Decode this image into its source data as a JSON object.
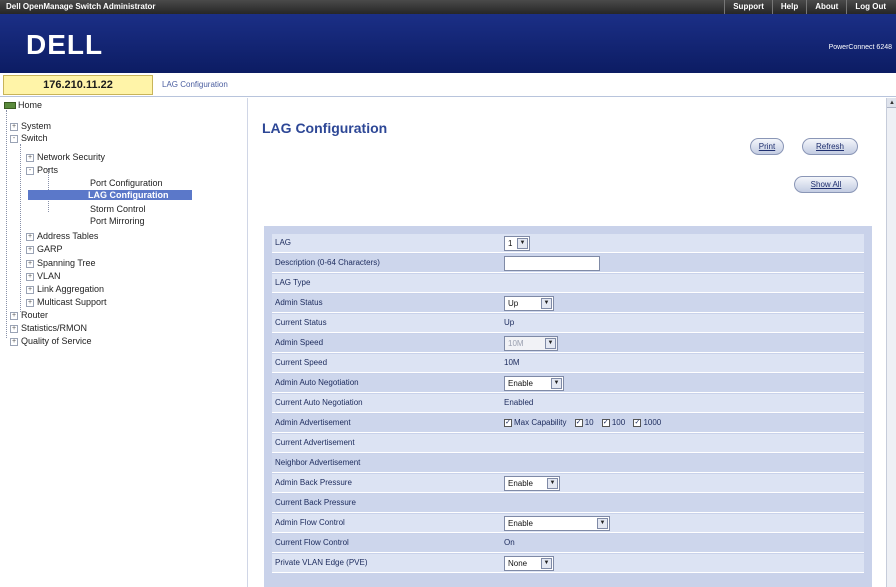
{
  "app_title": "Dell OpenManage Switch Administrator",
  "top_links": [
    "Support",
    "Help",
    "About",
    "Log Out"
  ],
  "brand": "DELL",
  "model": "PowerConnect 6248",
  "ip_address": "176.210.11.22",
  "breadcrumb": "LAG Configuration",
  "tree": {
    "home": "Home",
    "system": "System",
    "switch": "Switch",
    "network_security": "Network Security",
    "ports": "Ports",
    "port_configuration": "Port Configuration",
    "lag_configuration": "LAG Configuration",
    "storm_control": "Storm Control",
    "port_mirroring": "Port Mirroring",
    "address_tables": "Address Tables",
    "garp": "GARP",
    "spanning_tree": "Spanning Tree",
    "vlan": "VLAN",
    "link_aggregation": "Link Aggregation",
    "multicast_support": "Multicast Support",
    "router": "Router",
    "statistics_rmon": "Statistics/RMON",
    "quality_of_service": "Quality of Service"
  },
  "page_title": "LAG Configuration",
  "buttons": {
    "print": "Print",
    "refresh": "Refresh",
    "show_all": "Show All"
  },
  "form": {
    "lag": {
      "label": "LAG",
      "value": "1"
    },
    "description": {
      "label": "Description (0-64 Characters)",
      "value": ""
    },
    "lag_type": {
      "label": "LAG Type",
      "value": ""
    },
    "admin_status": {
      "label": "Admin Status",
      "value": "Up"
    },
    "current_status": {
      "label": "Current Status",
      "value": "Up"
    },
    "admin_speed": {
      "label": "Admin Speed",
      "value": "10M"
    },
    "current_speed": {
      "label": "Current Speed",
      "value": "10M"
    },
    "admin_auto_negotiation": {
      "label": "Admin Auto Negotiation",
      "value": "Enable"
    },
    "current_auto_negotiation": {
      "label": "Current Auto Negotiation",
      "value": "Enabled"
    },
    "admin_advertisement": {
      "label": "Admin Advertisement",
      "options": [
        {
          "label": "Max Capability",
          "checked": true
        },
        {
          "label": "10",
          "checked": true
        },
        {
          "label": "100",
          "checked": true
        },
        {
          "label": "1000",
          "checked": true
        }
      ]
    },
    "current_advertisement": {
      "label": "Current Advertisement",
      "value": ""
    },
    "neighbor_advertisement": {
      "label": "Neighbor Advertisement",
      "value": ""
    },
    "admin_back_pressure": {
      "label": "Admin Back Pressure",
      "value": "Enable"
    },
    "current_back_pressure": {
      "label": "Current Back Pressure",
      "value": ""
    },
    "admin_flow_control": {
      "label": "Admin Flow Control",
      "value": "Enable"
    },
    "current_flow_control": {
      "label": "Current Flow Control",
      "value": "On"
    },
    "private_vlan_edge": {
      "label": "Private VLAN Edge (PVE)",
      "value": "None"
    }
  }
}
